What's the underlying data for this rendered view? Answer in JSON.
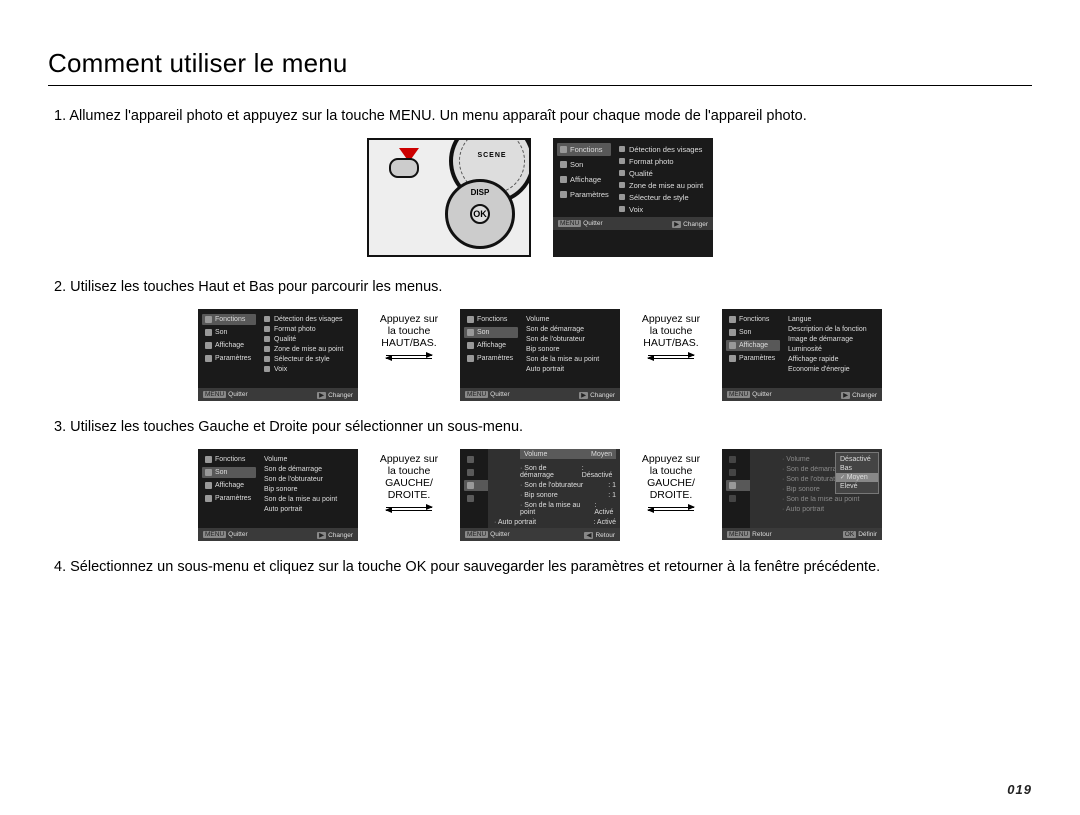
{
  "title": "Comment utiliser le menu",
  "page_number": "019",
  "steps": {
    "s1": "1. Allumez l'appareil photo et appuyez sur la touche MENU.  Un menu apparaît pour chaque mode de l'appareil photo.",
    "s2": "2. Utilisez les touches Haut et Bas pour parcourir les menus.",
    "s3": "3. Utilisez les touches Gauche et Droite pour sélectionner un sous-menu.",
    "s4": "4. Sélectionnez un sous-menu et cliquez sur la touche OK pour sauvegarder les paramètres et retourner à la fenêtre précédente."
  },
  "between": {
    "hb_line1": "Appuyez sur",
    "hb_line2": "la touche",
    "hb_line3": "HAUT/BAS.",
    "gd_line1": "Appuyez sur",
    "gd_line2": "la touche",
    "gd_line3": "GAUCHE/",
    "gd_line4": "DROITE."
  },
  "camera": {
    "dial_label": "SCENE",
    "dpad_top": "DISP",
    "ok": "OK"
  },
  "left_menu": {
    "fonctions": "Fonctions",
    "son": "Son",
    "affichage": "Affichage",
    "parametres": "Paramètres"
  },
  "fonctions_opts": {
    "o1": "Détection des visages",
    "o2": "Format photo",
    "o3": "Qualité",
    "o4": "Zone de mise au point",
    "o5": "Sélecteur de style",
    "o6": "Voix"
  },
  "son_opts": {
    "o1": "Volume",
    "o2": "Son de démarrage",
    "o3": "Son de l'obturateur",
    "o4": "Bip sonore",
    "o5": "Son de la mise au point",
    "o6": "Auto portrait"
  },
  "aff_opts": {
    "o1": "Langue",
    "o2": "Description de la fonction",
    "o3": "Image de démarrage",
    "o4": "Luminosité",
    "o5": "Affichage rapide",
    "o6": "Economie d'énergie"
  },
  "son_values": {
    "header_k": "Volume",
    "header_v": "Moyen",
    "k1": "Son de démarrage",
    "v1": ": Désactivé",
    "k2": "Son de l'obturateur",
    "v2": ": 1",
    "k3": "Bip sonore",
    "v3": ": 1",
    "k4": "Son de la mise au point",
    "v4": ": Activé",
    "k5": "Auto portrait",
    "v5": ": Activé"
  },
  "popup": {
    "p1": "Désactivé",
    "p2": "Bas",
    "p3": "Moyen",
    "p4": "Elevé"
  },
  "footer": {
    "menu_tag": "MENU",
    "play_tag": "▶",
    "back_tag": "◀",
    "ok_tag": "OK",
    "quitter": "Quitter",
    "changer": "Changer",
    "retour": "Retour",
    "definir": "Définir"
  }
}
